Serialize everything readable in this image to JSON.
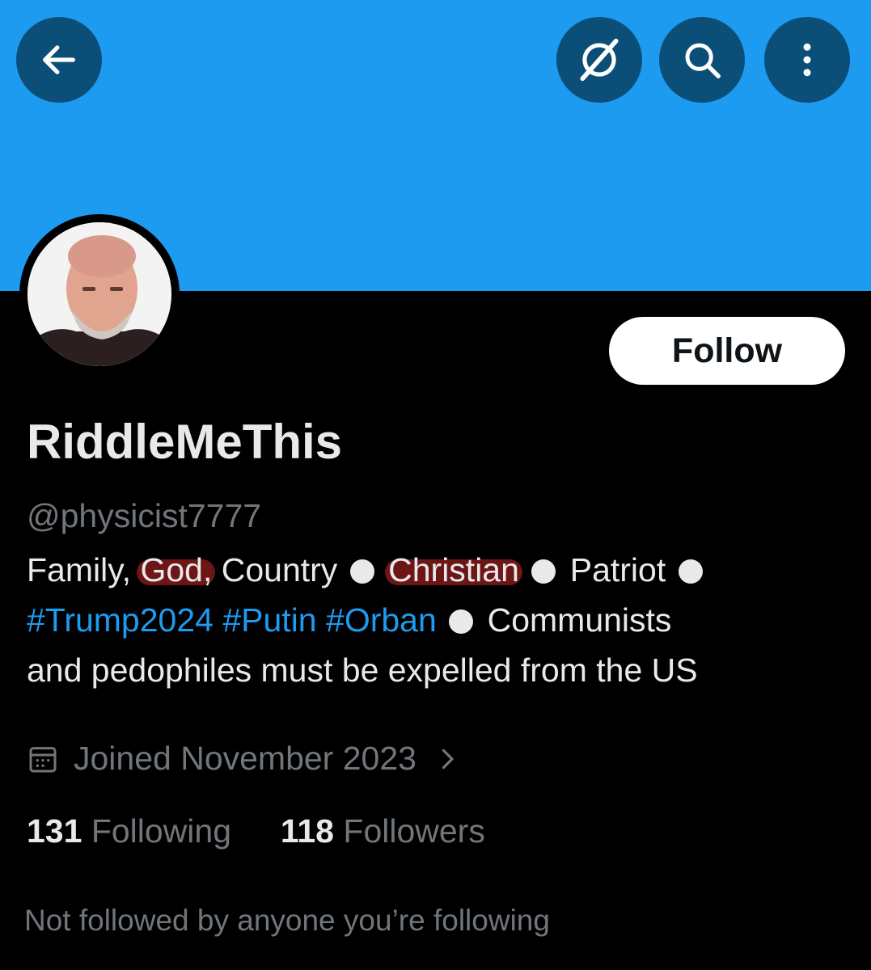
{
  "header": {
    "back_icon": "arrow-left-icon",
    "grok_icon": "grok-icon",
    "search_icon": "search-icon",
    "more_icon": "more-vertical-icon",
    "banner_color": "#1d9bf0",
    "button_color": "#0b4f79"
  },
  "profile": {
    "follow_label": "Follow",
    "display_name": "RiddleMeThis",
    "handle": "@physicist7777",
    "bio": {
      "line1_a": "Family, ",
      "line1_god": "God,",
      "line1_b": " Country",
      "line1_christian": "Christian",
      "line1_patriot": "Patriot",
      "hashtag1": "#Trump2024",
      "hashtag2": "#Putin",
      "hashtag3": "#Orban",
      "line2_text": "Communists",
      "line3_text": "and pedophiles must be expelled from the US"
    },
    "joined": "Joined November 2023",
    "following_count": "131",
    "following_label": "Following",
    "followers_count": "118",
    "followers_label": "Followers",
    "not_followed": "Not followed by anyone you’re following"
  }
}
